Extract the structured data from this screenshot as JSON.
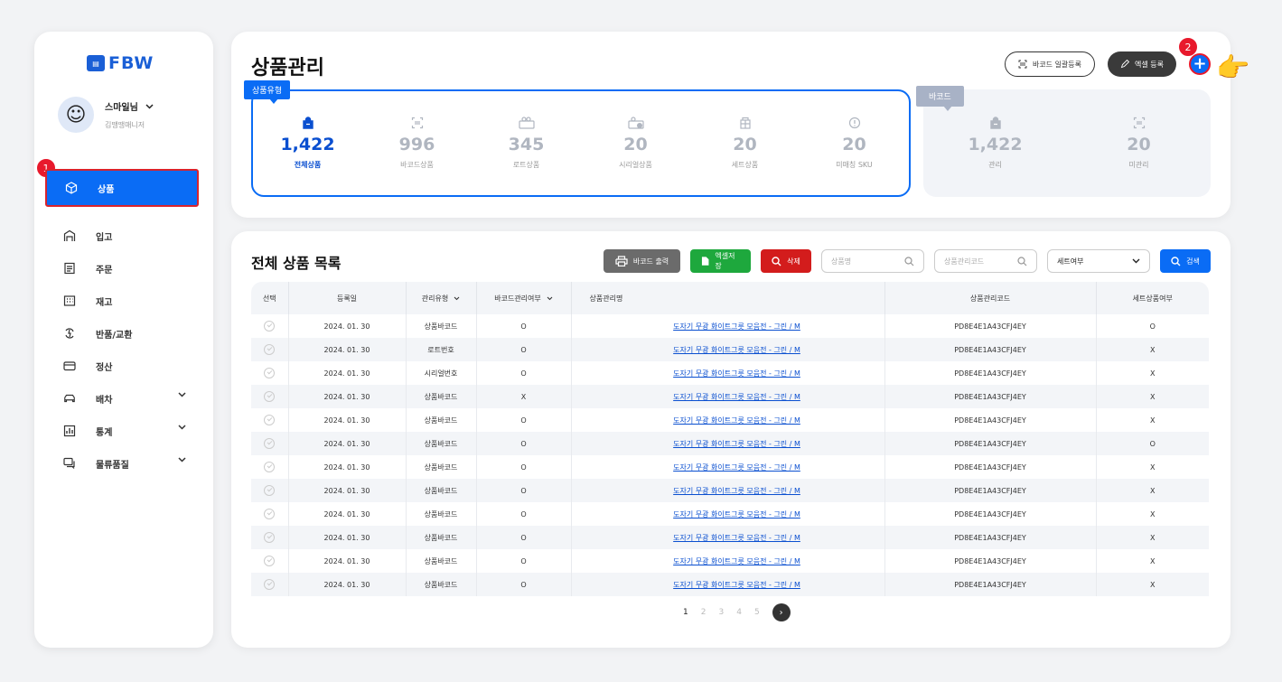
{
  "sidebar": {
    "logo_text": "FBW",
    "profile": {
      "name": "스마일님",
      "role": "김땡땡매니저"
    },
    "menu_badge": "1",
    "items": [
      {
        "label": "상품",
        "icon": "box-icon",
        "active": true,
        "has_chevron": false
      },
      {
        "label": "입고",
        "icon": "warehouse-icon",
        "active": false,
        "has_chevron": false
      },
      {
        "label": "주문",
        "icon": "receipt-icon",
        "active": false,
        "has_chevron": false
      },
      {
        "label": "재고",
        "icon": "grid-icon",
        "active": false,
        "has_chevron": false
      },
      {
        "label": "반품/교환",
        "icon": "exchange-icon",
        "active": false,
        "has_chevron": false
      },
      {
        "label": "정산",
        "icon": "card-icon",
        "active": false,
        "has_chevron": false
      },
      {
        "label": "배차",
        "icon": "car-icon",
        "active": false,
        "has_chevron": true
      },
      {
        "label": "통계",
        "icon": "chart-icon",
        "active": false,
        "has_chevron": true
      },
      {
        "label": "물류품질",
        "icon": "chat-icon",
        "active": false,
        "has_chevron": true
      }
    ]
  },
  "header": {
    "title": "상품관리",
    "barcode_bulk_label": "바코드 일괄등록",
    "excel_register_label": "엑셀 등록",
    "add_badge": "2",
    "add_label": "+"
  },
  "stats": {
    "tag": "상품유형",
    "items": [
      {
        "value": "1,422",
        "label": "전체상품",
        "icon": "bag-icon"
      },
      {
        "value": "996",
        "label": "바코드상품",
        "icon": "barcode-icon"
      },
      {
        "value": "345",
        "label": "로트상품",
        "icon": "lot-icon"
      },
      {
        "value": "20",
        "label": "시리얼상품",
        "icon": "serial-icon"
      },
      {
        "value": "20",
        "label": "세트상품",
        "icon": "set-icon"
      },
      {
        "value": "20",
        "label": "미매칭 SKU",
        "icon": "info-icon"
      }
    ]
  },
  "barcode_stats": {
    "tag": "바코드",
    "items": [
      {
        "value": "1,422",
        "label": "관리",
        "icon": "bag-icon"
      },
      {
        "value": "20",
        "label": "미관리",
        "icon": "barcode-icon"
      }
    ]
  },
  "list": {
    "title": "전체 상품 목록",
    "print_barcode_label": "바코드 출력",
    "excel_save_label": "엑셀저장",
    "delete_label": "삭제",
    "name_search_placeholder": "상품명",
    "code_search_placeholder": "상품관리코드",
    "set_select_value": "세트여부",
    "search_label": "검색",
    "columns": [
      "선택",
      "등록일",
      "관리유형",
      "바코드관리여부",
      "상품관리명",
      "상품관리코드",
      "세트상품여부"
    ],
    "rows": [
      {
        "date": "2024. 01. 30",
        "type": "상품바코드",
        "barcode": "O",
        "name": "도자기 무광 화이트그릇 모음전 - 그린 / M",
        "code": "PD8E4E1A43CFJ4EY",
        "set": "O"
      },
      {
        "date": "2024. 01. 30",
        "type": "로트번호",
        "barcode": "O",
        "name": "도자기 무광 화이트그릇 모음전 - 그린 / M",
        "code": "PD8E4E1A43CFJ4EY",
        "set": "X"
      },
      {
        "date": "2024. 01. 30",
        "type": "시리얼번호",
        "barcode": "O",
        "name": "도자기 무광 화이트그릇 모음전 - 그린 / M",
        "code": "PD8E4E1A43CFJ4EY",
        "set": "X"
      },
      {
        "date": "2024. 01. 30",
        "type": "상품바코드",
        "barcode": "X",
        "name": "도자기 무광 화이트그릇 모음전 - 그린 / M",
        "code": "PD8E4E1A43CFJ4EY",
        "set": "X"
      },
      {
        "date": "2024. 01. 30",
        "type": "상품바코드",
        "barcode": "O",
        "name": "도자기 무광 화이트그릇 모음전 - 그린 / M",
        "code": "PD8E4E1A43CFJ4EY",
        "set": "X"
      },
      {
        "date": "2024. 01. 30",
        "type": "상품바코드",
        "barcode": "O",
        "name": "도자기 무광 화이트그릇 모음전 - 그린 / M",
        "code": "PD8E4E1A43CFJ4EY",
        "set": "O"
      },
      {
        "date": "2024. 01. 30",
        "type": "상품바코드",
        "barcode": "O",
        "name": "도자기 무광 화이트그릇 모음전 - 그린 / M",
        "code": "PD8E4E1A43CFJ4EY",
        "set": "X"
      },
      {
        "date": "2024. 01. 30",
        "type": "상품바코드",
        "barcode": "O",
        "name": "도자기 무광 화이트그릇 모음전 - 그린 / M",
        "code": "PD8E4E1A43CFJ4EY",
        "set": "X"
      },
      {
        "date": "2024. 01. 30",
        "type": "상품바코드",
        "barcode": "O",
        "name": "도자기 무광 화이트그릇 모음전 - 그린 / M",
        "code": "PD8E4E1A43CFJ4EY",
        "set": "X"
      },
      {
        "date": "2024. 01. 30",
        "type": "상품바코드",
        "barcode": "O",
        "name": "도자기 무광 화이트그릇 모음전 - 그린 / M",
        "code": "PD8E4E1A43CFJ4EY",
        "set": "X"
      },
      {
        "date": "2024. 01. 30",
        "type": "상품바코드",
        "barcode": "O",
        "name": "도자기 무광 화이트그릇 모음전 - 그린 / M",
        "code": "PD8E4E1A43CFJ4EY",
        "set": "X"
      },
      {
        "date": "2024. 01. 30",
        "type": "상품바코드",
        "barcode": "O",
        "name": "도자기 무광 화이트그릇 모음전 - 그린 / M",
        "code": "PD8E4E1A43CFJ4EY",
        "set": "X"
      }
    ],
    "pages": [
      "1",
      "2",
      "3",
      "4",
      "5"
    ],
    "current_page": "1",
    "next_label": "›"
  },
  "colors": {
    "primary": "#0a6cf5",
    "danger": "#d31c1c",
    "success": "#1ea83d",
    "highlight": "#e8192c"
  }
}
